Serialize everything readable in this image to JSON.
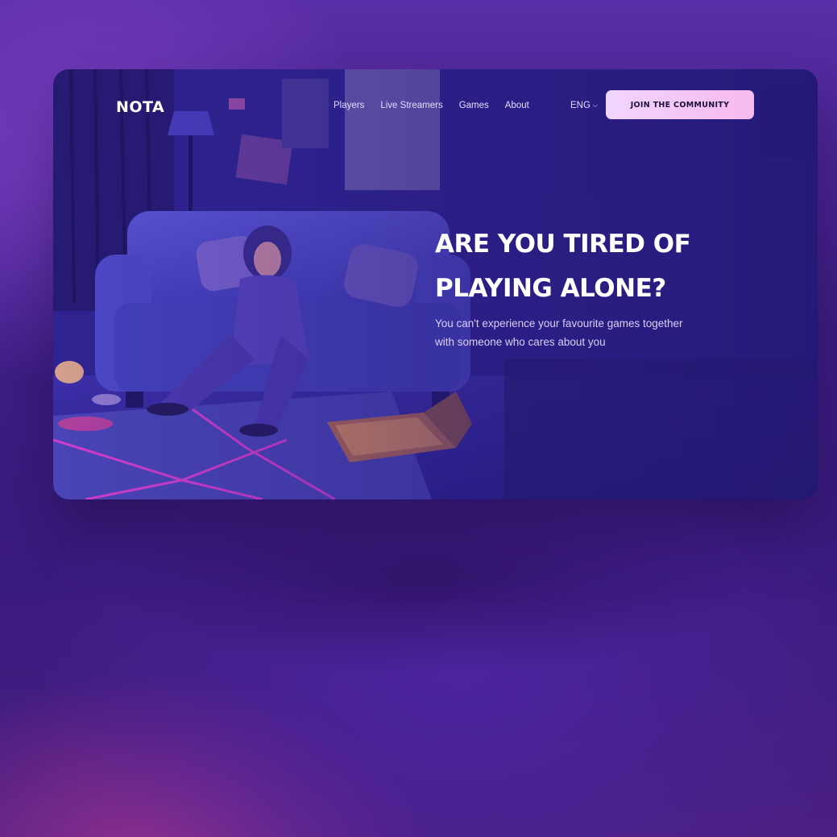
{
  "header": {
    "logo": "NOTA",
    "nav": [
      "Players",
      "Live Streamers",
      "Games",
      "About"
    ],
    "language": "ENG",
    "cta_label": "JOIN THE COMMUNITY"
  },
  "hero": {
    "title_line1": "ARE YOU TIRED OF",
    "title_line2": "PLAYING ALONE?",
    "subtitle_line1": "You can't experience your favourite games together",
    "subtitle_line2": "with someone who cares about you"
  },
  "icons": {
    "language_dropdown": "chevron-down-icon"
  },
  "colors": {
    "background": "#4a239a",
    "card": "#2b1b88",
    "cta_start": "#f1d6ff",
    "cta_end": "#f7b9ee",
    "rug_lines": "#e23fd0"
  }
}
